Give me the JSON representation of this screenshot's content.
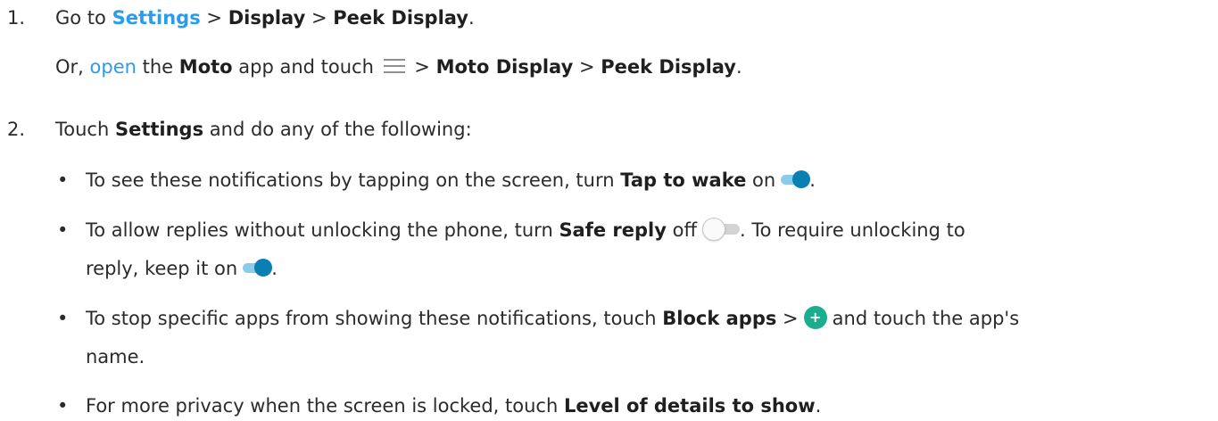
{
  "step1": {
    "number": "1.",
    "go_to": "Go to",
    "settings_link": "Settings",
    "sep1": ">",
    "display": "Display",
    "sep2": ">",
    "peek_display": "Peek Display",
    "end": ".",
    "alt_or": "Or,",
    "alt_open_link": "open",
    "alt_the": "the",
    "alt_moto": "Moto",
    "alt_app_touch": "app and touch",
    "alt_sep1": ">",
    "alt_moto_display": "Moto Display",
    "alt_sep2": ">",
    "alt_peek_display": "Peek Display",
    "alt_end": "."
  },
  "step2": {
    "number": "2.",
    "touch": "Touch",
    "settings": "Settings",
    "rest": "and do any of the following:"
  },
  "bullets": {
    "symbol": "•",
    "b1": {
      "pre": "To see these notifications by tapping on the screen, turn",
      "strong": "Tap to wake",
      "post": "on",
      "end": "."
    },
    "b2": {
      "pre": "To allow replies without unlocking the phone, turn",
      "strong": "Safe reply",
      "post": "off",
      "mid": ". To require unlocking to",
      "line2_pre": "reply, keep it on",
      "end": "."
    },
    "b3": {
      "pre": "To stop specific apps from showing these notifications, touch",
      "strong": "Block apps",
      "sep": ">",
      "plus": "+",
      "post": "and touch the app's",
      "line2": "name."
    },
    "b4": {
      "pre": "For more privacy when the screen is locked, touch",
      "strong": "Level of details to show",
      "end": "."
    }
  },
  "icons": {
    "menu": "menu-icon",
    "toggle_on": "toggle-on-icon",
    "toggle_off": "toggle-off-icon",
    "add": "add-icon"
  },
  "colors": {
    "link": "#2b9cec",
    "toggle_on_knob": "#0a7fb3",
    "toggle_on_track": "#8bcbea",
    "add_button": "#1bae8e"
  }
}
